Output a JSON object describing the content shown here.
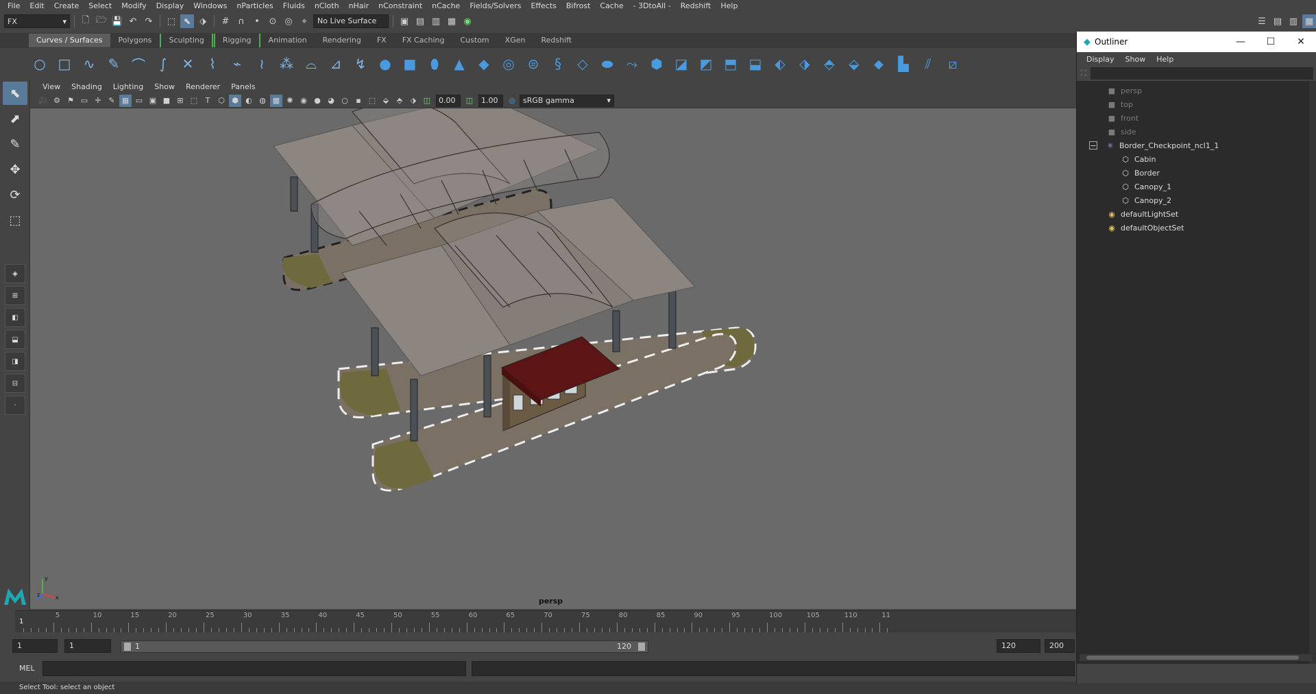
{
  "menubar": [
    "File",
    "Edit",
    "Create",
    "Select",
    "Modify",
    "Display",
    "Windows",
    "nParticles",
    "Fluids",
    "nCloth",
    "nHair",
    "nConstraint",
    "nCache",
    "Fields/Solvers",
    "Effects",
    "Bifrost",
    "Cache",
    "- 3DtoAll -",
    "Redshift",
    "Help"
  ],
  "statusline": {
    "mode": "FX",
    "live_surface": "No Live Surface"
  },
  "shelf_tabs": [
    "Curves / Surfaces",
    "Polygons",
    "Sculpting",
    "Rigging",
    "Animation",
    "Rendering",
    "FX",
    "FX Caching",
    "Custom",
    "XGen",
    "Redshift"
  ],
  "viewport": {
    "menu": [
      "View",
      "Shading",
      "Lighting",
      "Show",
      "Renderer",
      "Panels"
    ],
    "exposure": "0.00",
    "gamma": "1.00",
    "color_space": "sRGB gamma",
    "camera_label": "persp",
    "axis": {
      "x": "x",
      "y": "y",
      "z": "z"
    }
  },
  "timeline": {
    "ticks": [
      "5",
      "10",
      "15",
      "20",
      "25",
      "30",
      "35",
      "40",
      "45",
      "50",
      "55",
      "60",
      "65",
      "70",
      "75",
      "80",
      "85",
      "90",
      "95",
      "100",
      "105",
      "110",
      "11"
    ],
    "current_frame": "1"
  },
  "range": {
    "start": "1",
    "anim_start": "1",
    "playback_start": "1",
    "playback_end": "120",
    "end": "120",
    "anim_end": "200"
  },
  "cmdline": {
    "label": "MEL"
  },
  "helpline": "Select Tool: select an object",
  "outliner": {
    "title": "Outliner",
    "menu": [
      "Display",
      "Show",
      "Help"
    ],
    "items": [
      {
        "label": "persp",
        "icon": "camera-icon",
        "dim": true
      },
      {
        "label": "top",
        "icon": "camera-icon",
        "dim": true
      },
      {
        "label": "front",
        "icon": "camera-icon",
        "dim": true
      },
      {
        "label": "side",
        "icon": "camera-icon",
        "dim": true
      },
      {
        "label": "Border_Checkpoint_ncl1_1",
        "icon": "group-icon",
        "dim": false
      },
      {
        "label": "Cabin",
        "icon": "mesh-icon",
        "dim": false
      },
      {
        "label": "Border",
        "icon": "mesh-icon",
        "dim": false
      },
      {
        "label": "Canopy_1",
        "icon": "mesh-icon",
        "dim": false
      },
      {
        "label": "Canopy_2",
        "icon": "mesh-icon",
        "dim": false
      },
      {
        "label": "defaultLightSet",
        "icon": "set-icon",
        "dim": false
      },
      {
        "label": "defaultObjectSet",
        "icon": "set-icon",
        "dim": false
      }
    ]
  }
}
